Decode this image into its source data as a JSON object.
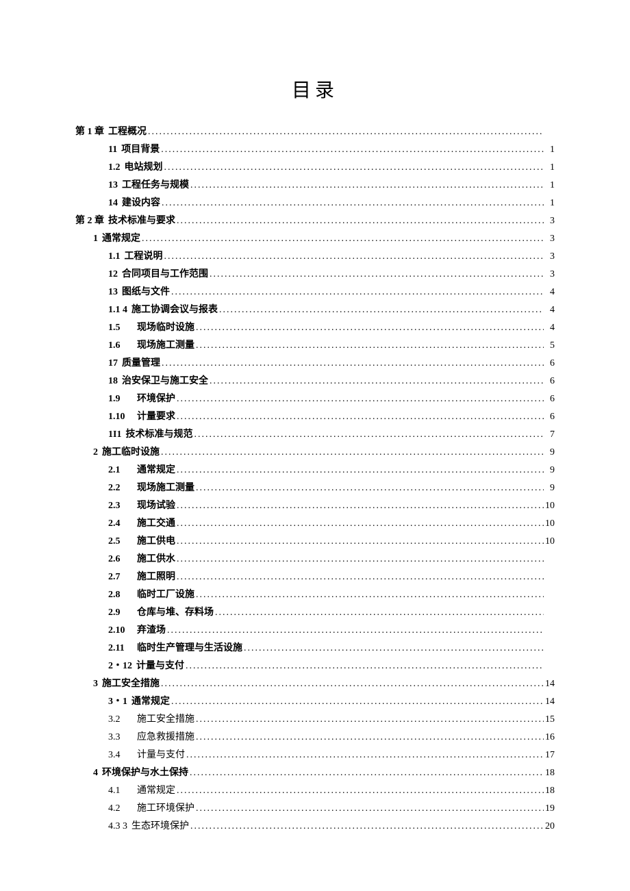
{
  "title": "目录",
  "entries": [
    {
      "indent": 0,
      "bold": true,
      "num": "第 1 章",
      "numWide": false,
      "label": "工程概况",
      "page": ""
    },
    {
      "indent": 2,
      "bold": true,
      "num": "11",
      "numWide": false,
      "label": "项目背景",
      "page": "1"
    },
    {
      "indent": 2,
      "bold": true,
      "num": "1.2",
      "numWide": false,
      "label": "电站规划",
      "page": "1"
    },
    {
      "indent": 2,
      "bold": true,
      "num": "13",
      "numWide": false,
      "label": "工程任务与规模",
      "page": "1"
    },
    {
      "indent": 2,
      "bold": true,
      "num": "14",
      "numWide": false,
      "label": "建设内容",
      "page": "1"
    },
    {
      "indent": 0,
      "bold": true,
      "num": "第 2 章",
      "numWide": false,
      "label": "技术标准与要求",
      "page": "3"
    },
    {
      "indent": 1,
      "bold": true,
      "num": "1",
      "numWide": false,
      "label": "通常规定",
      "page": "3"
    },
    {
      "indent": 2,
      "bold": true,
      "num": "1.1",
      "numWide": false,
      "label": "工程说明",
      "page": "3"
    },
    {
      "indent": 2,
      "bold": true,
      "num": "12",
      "numWide": false,
      "label": "合同项目与工作范围",
      "page": "3"
    },
    {
      "indent": 2,
      "bold": true,
      "num": "13",
      "numWide": false,
      "label": "图纸与文件",
      "page": "4"
    },
    {
      "indent": 2,
      "bold": true,
      "num": "1.1  4",
      "numWide": false,
      "label": "施工协调会议与报表",
      "page": "4"
    },
    {
      "indent": 2,
      "bold": true,
      "num": "1.5",
      "numWide": true,
      "label": "现场临时设施",
      "page": "4"
    },
    {
      "indent": 2,
      "bold": true,
      "num": "1.6",
      "numWide": true,
      "label": "现场施工测量",
      "page": "5"
    },
    {
      "indent": 2,
      "bold": true,
      "num": "17",
      "numWide": false,
      "label": "质量管理",
      "page": "6"
    },
    {
      "indent": 2,
      "bold": true,
      "num": "18",
      "numWide": false,
      "label": "治安保卫与施工安全",
      "page": "6"
    },
    {
      "indent": 2,
      "bold": true,
      "num": "1.9",
      "numWide": true,
      "label": "环境保护",
      "page": "6"
    },
    {
      "indent": 2,
      "bold": true,
      "num": "1.10",
      "numWide": true,
      "label": "计量要求",
      "page": "6"
    },
    {
      "indent": 2,
      "bold": true,
      "num": "1I1",
      "numWide": false,
      "label": "技术标准与规范",
      "page": "7"
    },
    {
      "indent": 1,
      "bold": true,
      "num": "2",
      "numWide": false,
      "label": "施工临时设施",
      "page": "9"
    },
    {
      "indent": 2,
      "bold": true,
      "num": "2.1",
      "numWide": true,
      "label": "通常规定",
      "page": "9"
    },
    {
      "indent": 2,
      "bold": true,
      "num": "2.2",
      "numWide": true,
      "label": "现场施工测量",
      "page": "9"
    },
    {
      "indent": 2,
      "bold": true,
      "num": "2.3",
      "numWide": true,
      "label": "现场试验",
      "page": "10"
    },
    {
      "indent": 2,
      "bold": true,
      "num": "2.4",
      "numWide": true,
      "label": "施工交通",
      "page": "10"
    },
    {
      "indent": 2,
      "bold": true,
      "num": "2.5",
      "numWide": true,
      "label": "施工供电",
      "page": "10"
    },
    {
      "indent": 2,
      "bold": true,
      "num": "2.6",
      "numWide": true,
      "label": "施工供水",
      "page": ""
    },
    {
      "indent": 2,
      "bold": true,
      "num": "2.7",
      "numWide": true,
      "label": "施工照明",
      "page": ""
    },
    {
      "indent": 2,
      "bold": true,
      "num": "2.8",
      "numWide": true,
      "label": "临时工厂设施",
      "page": ""
    },
    {
      "indent": 2,
      "bold": true,
      "num": "2.9",
      "numWide": true,
      "label": "仓库与堆、存料场",
      "page": ""
    },
    {
      "indent": 2,
      "bold": true,
      "num": "2.10",
      "numWide": true,
      "label": "弃渣场",
      "page": ""
    },
    {
      "indent": 2,
      "bold": true,
      "num": "2.11",
      "numWide": true,
      "label": "临时生产管理与生活设施",
      "page": ""
    },
    {
      "indent": 2,
      "bold": true,
      "num": "2・12",
      "numWide": false,
      "label": "计量与支付",
      "page": ""
    },
    {
      "indent": 1,
      "bold": true,
      "num": "3",
      "numWide": false,
      "label": "施工安全措施",
      "page": "14"
    },
    {
      "indent": 2,
      "bold": true,
      "num": "3・1",
      "numWide": false,
      "label": "通常规定",
      "page": "14"
    },
    {
      "indent": 2,
      "bold": false,
      "num": "3.2",
      "numWide": true,
      "label": "施工安全措施",
      "page": "15"
    },
    {
      "indent": 2,
      "bold": false,
      "num": "3.3",
      "numWide": true,
      "label": "应急救援措施",
      "page": "16"
    },
    {
      "indent": 2,
      "bold": false,
      "num": "3.4",
      "numWide": true,
      "label": "计量与支付",
      "page": "17"
    },
    {
      "indent": 1,
      "bold": true,
      "num": "4",
      "numWide": false,
      "label": "环境保护与水土保持",
      "page": "18"
    },
    {
      "indent": 2,
      "bold": false,
      "num": "4.1",
      "numWide": true,
      "label": "通常规定",
      "page": "18"
    },
    {
      "indent": 2,
      "bold": false,
      "num": "4.2",
      "numWide": true,
      "label": "施工环境保护",
      "page": "19"
    },
    {
      "indent": 2,
      "bold": false,
      "num": "4.3  3",
      "numWide": false,
      "label": "生态环境保护",
      "page": "20"
    }
  ]
}
